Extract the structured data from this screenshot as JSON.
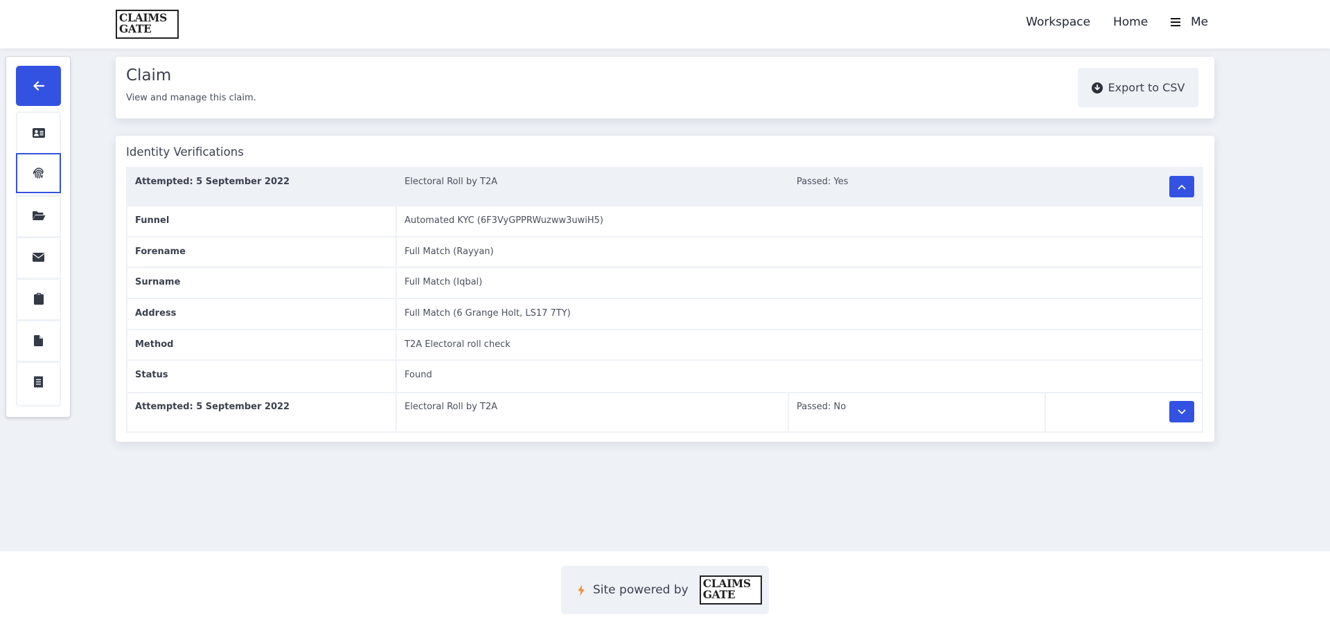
{
  "header": {
    "logo": {
      "line1": "CLAIMS",
      "line2": "GATE"
    },
    "nav": {
      "workspace": "Workspace",
      "home": "Home",
      "me": "Me"
    },
    "icons": {
      "menu": "menu-icon"
    }
  },
  "sidebar": {
    "back_icon": "arrow-left-icon",
    "items": [
      {
        "icon": "id-card-icon",
        "active": false
      },
      {
        "icon": "fingerprint-icon",
        "active": true
      },
      {
        "icon": "folder-open-icon",
        "active": false
      },
      {
        "icon": "envelope-icon",
        "active": false
      },
      {
        "icon": "clipboard-icon",
        "active": false
      },
      {
        "icon": "file-icon",
        "active": false
      },
      {
        "icon": "receipt-icon",
        "active": false
      }
    ]
  },
  "claim": {
    "title": "Claim",
    "subtitle": "View and manage this claim.",
    "export_label": "Export to CSV",
    "export_icon": "download-circle-icon"
  },
  "identity": {
    "title": "Identity Verifications",
    "attempts": [
      {
        "attempted": "Attempted: 5 September 2022",
        "provider": "Electoral Roll by T2A",
        "passed": "Passed: Yes",
        "expanded": true,
        "toggle_icon": "chevron-up-icon",
        "details": [
          {
            "label": "Funnel",
            "value": "Automated KYC (6F3VyGPPRWuzww3uwiH5)"
          },
          {
            "label": "Forename",
            "value": "Full Match (Rayyan)"
          },
          {
            "label": "Surname",
            "value": "Full Match (Iqbal)"
          },
          {
            "label": "Address",
            "value": "Full Match (6 Grange Holt, LS17 7TY)"
          },
          {
            "label": "Method",
            "value": "T2A Electoral roll check"
          },
          {
            "label": "Status",
            "value": "Found"
          }
        ]
      },
      {
        "attempted": "Attempted: 5 September 2022",
        "provider": "Electoral Roll by T2A",
        "passed": "Passed: No",
        "expanded": false,
        "toggle_icon": "chevron-down-icon"
      }
    ]
  },
  "footer": {
    "powered_by": "Site powered by",
    "logo": {
      "line1": "CLAIMS",
      "line2": "GATE"
    },
    "bolt_icon": "bolt-icon"
  },
  "colors": {
    "accent": "#3452e1",
    "background": "#eef1f6",
    "text": "#3c4150",
    "bolt": "#f58b2e"
  }
}
